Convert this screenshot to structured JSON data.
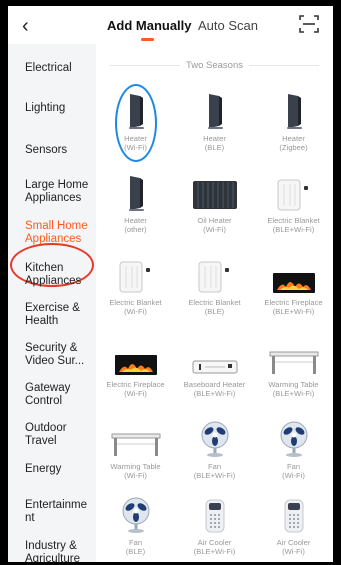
{
  "header": {
    "back_icon": "chevron-left-icon",
    "tab_add": "Add Manually",
    "tab_auto": "Auto Scan",
    "scan_icon": "scan-frame-icon",
    "accent": "#ff5a1f"
  },
  "sidebar": {
    "items": [
      {
        "label": "Electrical"
      },
      {
        "label": "Lighting"
      },
      {
        "label": "Sensors"
      },
      {
        "label": "Large Home Appliances"
      },
      {
        "label": "Small Home Appliances"
      },
      {
        "label": "Kitchen Appliances"
      },
      {
        "label": "Exercise & Health"
      },
      {
        "label": "Security & Video Sur..."
      },
      {
        "label": "Gateway Control"
      },
      {
        "label": "Outdoor Travel"
      },
      {
        "label": "Energy"
      },
      {
        "label": "Entertainme nt"
      },
      {
        "label": "Industry & Agriculture"
      }
    ],
    "active_index": 4
  },
  "content": {
    "section_title": "Two Seasons",
    "products": [
      {
        "name": "Heater",
        "proto": "(Wi-Fi)",
        "icon": "heater-icon"
      },
      {
        "name": "Heater",
        "proto": "(BLE)",
        "icon": "heater-icon"
      },
      {
        "name": "Heater",
        "proto": "(Zigbee)",
        "icon": "heater-icon"
      },
      {
        "name": "Heater",
        "proto": "(other)",
        "icon": "heater-icon"
      },
      {
        "name": "Oil Heater",
        "proto": "(Wi-Fi)",
        "icon": "oil-heater-icon"
      },
      {
        "name": "Electric Blanket",
        "proto": "(BLE+Wi-Fi)",
        "icon": "electric-blanket-icon"
      },
      {
        "name": "Electric Blanket",
        "proto": "(Wi-Fi)",
        "icon": "electric-blanket-icon"
      },
      {
        "name": "Electric Blanket",
        "proto": "(BLE)",
        "icon": "electric-blanket-icon"
      },
      {
        "name": "Electric Fireplace",
        "proto": "(BLE+Wi-Fi)",
        "icon": "electric-fireplace-icon"
      },
      {
        "name": "Electric Fireplace",
        "proto": "(Wi-Fi)",
        "icon": "electric-fireplace-icon"
      },
      {
        "name": "Baseboard Heater",
        "proto": "(BLE+Wi-Fi)",
        "icon": "baseboard-heater-icon"
      },
      {
        "name": "Warming Table",
        "proto": "(BLE+Wi-Fi)",
        "icon": "warming-table-icon"
      },
      {
        "name": "Warming Table",
        "proto": "(Wi-Fi)",
        "icon": "warming-table-icon"
      },
      {
        "name": "Fan",
        "proto": "(BLE+Wi-Fi)",
        "icon": "fan-icon"
      },
      {
        "name": "Fan",
        "proto": "(Wi-Fi)",
        "icon": "fan-icon"
      },
      {
        "name": "Fan",
        "proto": "(BLE)",
        "icon": "fan-icon"
      },
      {
        "name": "Air Cooler",
        "proto": "(BLE+Wi-Fi)",
        "icon": "air-cooler-icon"
      },
      {
        "name": "Air Cooler",
        "proto": "(Wi-Fi)",
        "icon": "air-cooler-icon"
      }
    ]
  }
}
